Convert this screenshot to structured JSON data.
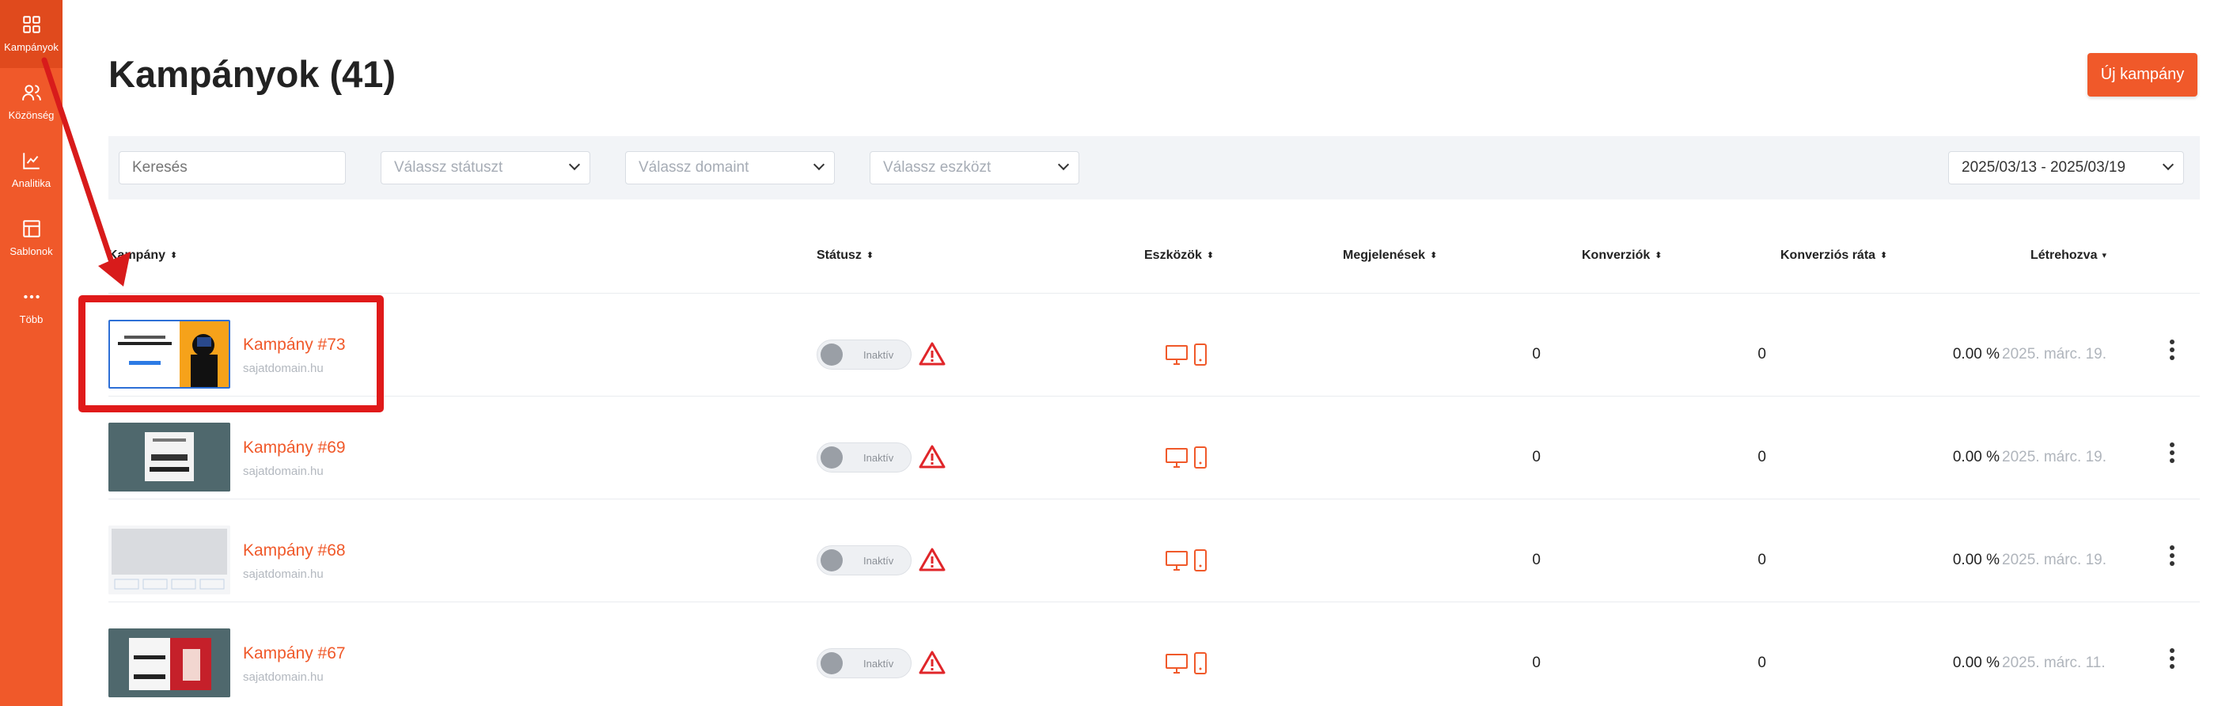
{
  "sidebar": {
    "items": [
      {
        "label": "Kampányok",
        "icon": "grid-icon"
      },
      {
        "label": "Közönség",
        "icon": "users-icon"
      },
      {
        "label": "Analitika",
        "icon": "chart-icon"
      },
      {
        "label": "Sablonok",
        "icon": "layout-icon"
      },
      {
        "label": "Több",
        "icon": "more-icon"
      }
    ]
  },
  "header": {
    "title": "Kampányok (41)",
    "new_button": "Új kampány"
  },
  "filters": {
    "search_placeholder": "Keresés",
    "status": "Válassz státuszt",
    "domain": "Válassz domaint",
    "device": "Válassz eszközt",
    "date_range": "2025/03/13 - 2025/03/19"
  },
  "table": {
    "columns": {
      "campaign": "Kampány",
      "status": "Státusz",
      "devices": "Eszközök",
      "impressions": "Megjelenések",
      "conversions": "Konverziók",
      "conversion_rate": "Konverziós ráta",
      "created": "Létrehozva"
    },
    "rows": [
      {
        "name": "Kampány #73",
        "domain": "sajatdomain.hu",
        "status": "Inaktív",
        "impressions": "0",
        "conversions": "0",
        "rate": "0.00 %",
        "created": "2025. márc. 19."
      },
      {
        "name": "Kampány #69",
        "domain": "sajatdomain.hu",
        "status": "Inaktív",
        "impressions": "0",
        "conversions": "0",
        "rate": "0.00 %",
        "created": "2025. márc. 19."
      },
      {
        "name": "Kampány #68",
        "domain": "sajatdomain.hu",
        "status": "Inaktív",
        "impressions": "0",
        "conversions": "0",
        "rate": "0.00 %",
        "created": "2025. márc. 19."
      },
      {
        "name": "Kampány #67",
        "domain": "sajatdomain.hu",
        "status": "Inaktív",
        "impressions": "0",
        "conversions": "0",
        "rate": "0.00 %",
        "created": "2025. márc. 11."
      }
    ]
  },
  "colors": {
    "brand": "#f0592a",
    "annotation": "#e01a1a",
    "warning": "#e0262a"
  }
}
